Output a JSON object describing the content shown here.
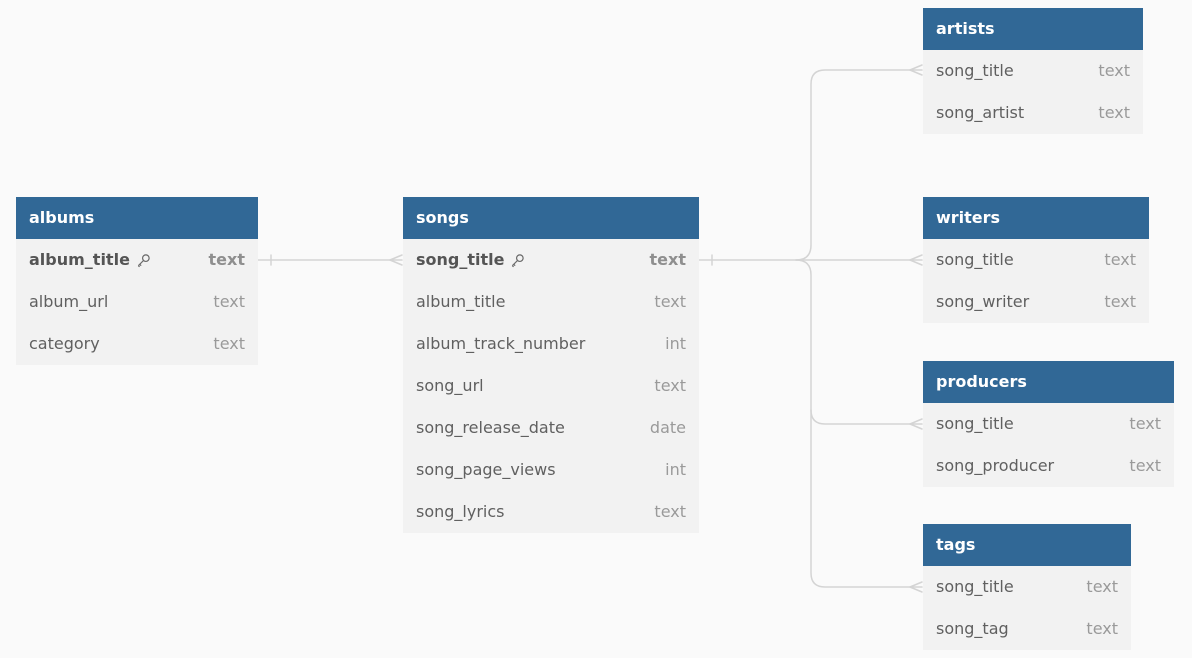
{
  "diagram": {
    "colors": {
      "header": "#316896",
      "header_text": "#ffffff",
      "body": "#f2f2f2",
      "field_text": "#606060",
      "type_text": "#9a9a9a",
      "connector": "#d4d4d4",
      "background": "#fafafa"
    },
    "tables": {
      "albums": {
        "name": "albums",
        "columns": [
          {
            "name": "album_title",
            "type": "text",
            "primary_key": true,
            "icon": "key-icon"
          },
          {
            "name": "album_url",
            "type": "text"
          },
          {
            "name": "category",
            "type": "text"
          }
        ]
      },
      "songs": {
        "name": "songs",
        "columns": [
          {
            "name": "song_title",
            "type": "text",
            "primary_key": true,
            "icon": "key-icon"
          },
          {
            "name": "album_title",
            "type": "text"
          },
          {
            "name": "album_track_number",
            "type": "int"
          },
          {
            "name": "song_url",
            "type": "text"
          },
          {
            "name": "song_release_date",
            "type": "date"
          },
          {
            "name": "song_page_views",
            "type": "int"
          },
          {
            "name": "song_lyrics",
            "type": "text"
          }
        ]
      },
      "artists": {
        "name": "artists",
        "columns": [
          {
            "name": "song_title",
            "type": "text"
          },
          {
            "name": "song_artist",
            "type": "text"
          }
        ]
      },
      "writers": {
        "name": "writers",
        "columns": [
          {
            "name": "song_title",
            "type": "text"
          },
          {
            "name": "song_writer",
            "type": "text"
          }
        ]
      },
      "producers": {
        "name": "producers",
        "columns": [
          {
            "name": "song_title",
            "type": "text"
          },
          {
            "name": "song_producer",
            "type": "text"
          }
        ]
      },
      "tags": {
        "name": "tags",
        "columns": [
          {
            "name": "song_title",
            "type": "text"
          },
          {
            "name": "song_tag",
            "type": "text"
          }
        ]
      }
    },
    "relationships": [
      {
        "from": "albums.album_title",
        "to": "songs.song_title",
        "from_end": "one",
        "to_end": "many"
      },
      {
        "from": "songs.song_title",
        "to": "artists.song_title",
        "from_end": "one",
        "to_end": "many"
      },
      {
        "from": "songs.song_title",
        "to": "writers.song_title",
        "from_end": "one",
        "to_end": "many"
      },
      {
        "from": "songs.song_title",
        "to": "producers.song_title",
        "from_end": "one",
        "to_end": "many"
      },
      {
        "from": "songs.song_title",
        "to": "tags.song_title",
        "from_end": "one",
        "to_end": "many"
      }
    ]
  }
}
